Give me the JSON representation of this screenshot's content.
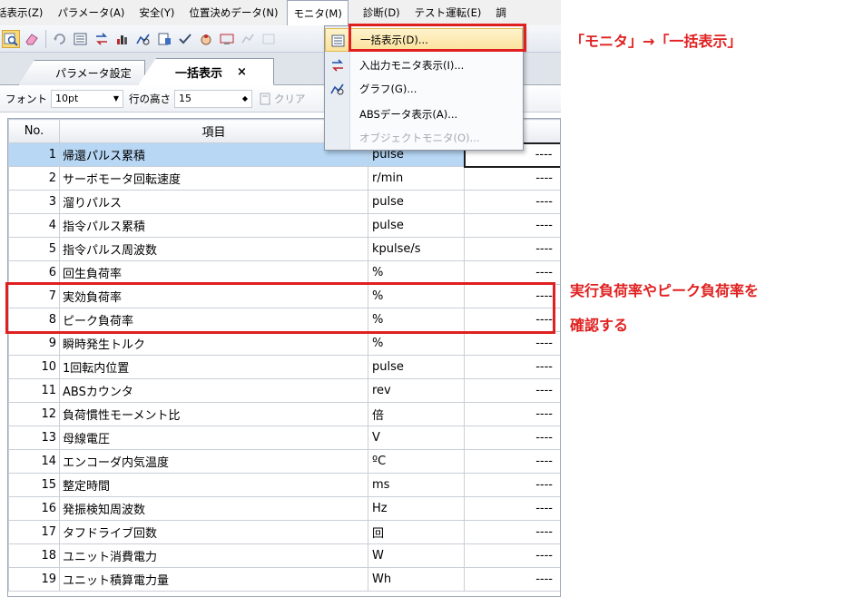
{
  "menubar": {
    "items": [
      {
        "label": "話表示(Z)"
      },
      {
        "label": "パラメータ(A)"
      },
      {
        "label": "安全(Y)"
      },
      {
        "label": "位置決めデータ(N)"
      },
      {
        "label": "モニタ(M)"
      },
      {
        "label": "診断(D)"
      },
      {
        "label": "テスト運転(E)"
      },
      {
        "label": "調"
      }
    ]
  },
  "tabs": {
    "tab1": "パラメータ設定",
    "tab2": "一括表示",
    "close": "×"
  },
  "fontbar": {
    "font_label": "フォント",
    "font_value": "10pt",
    "row_height_label": "行の高さ",
    "row_height_value": "15",
    "clear_label": "クリア"
  },
  "table": {
    "headers": {
      "no": "No.",
      "item": "項目"
    },
    "rows": [
      {
        "no": "1",
        "item": "帰還パルス累積",
        "unit": "pulse",
        "value": "----"
      },
      {
        "no": "2",
        "item": "サーボモータ回転速度",
        "unit": "r/min",
        "value": "----"
      },
      {
        "no": "3",
        "item": "溜りパルス",
        "unit": "pulse",
        "value": "----"
      },
      {
        "no": "4",
        "item": "指令パルス累積",
        "unit": "pulse",
        "value": "----"
      },
      {
        "no": "5",
        "item": "指令パルス周波数",
        "unit": "kpulse/s",
        "value": "----"
      },
      {
        "no": "6",
        "item": "回生負荷率",
        "unit": "%",
        "value": "----"
      },
      {
        "no": "7",
        "item": "実効負荷率",
        "unit": "%",
        "value": "----"
      },
      {
        "no": "8",
        "item": "ピーク負荷率",
        "unit": "%",
        "value": "----"
      },
      {
        "no": "9",
        "item": "瞬時発生トルク",
        "unit": "%",
        "value": "----"
      },
      {
        "no": "10",
        "item": "1回転内位置",
        "unit": "pulse",
        "value": "----"
      },
      {
        "no": "11",
        "item": "ABSカウンタ",
        "unit": "rev",
        "value": "----"
      },
      {
        "no": "12",
        "item": "負荷慣性モーメント比",
        "unit": "倍",
        "value": "----"
      },
      {
        "no": "13",
        "item": "母線電圧",
        "unit": "V",
        "value": "----"
      },
      {
        "no": "14",
        "item": "エンコーダ内気温度",
        "unit": "ºC",
        "value": "----"
      },
      {
        "no": "15",
        "item": "整定時間",
        "unit": "ms",
        "value": "----"
      },
      {
        "no": "16",
        "item": "発振検知周波数",
        "unit": "Hz",
        "value": "----"
      },
      {
        "no": "17",
        "item": "タフドライブ回数",
        "unit": "回",
        "value": "----"
      },
      {
        "no": "18",
        "item": "ユニット消費電力",
        "unit": "W",
        "value": "----"
      },
      {
        "no": "19",
        "item": "ユニット積算電力量",
        "unit": "Wh",
        "value": "----"
      }
    ]
  },
  "dropdown": {
    "items": [
      {
        "label": "一括表示(D)...",
        "icon": "batch-display-icon"
      },
      {
        "label": "入出力モニタ表示(I)...",
        "icon": "io-monitor-icon"
      },
      {
        "label": "グラフ(G)...",
        "icon": "graph-icon"
      },
      {
        "label": "ABSデータ表示(A)...",
        "icon": ""
      },
      {
        "label": "オブジェクトモニタ(O)...",
        "icon": ""
      }
    ]
  },
  "annotations": {
    "menu_note": "「モニタ」→「一括表示」",
    "table_note_line1": "実行負荷率やピーク負荷率を",
    "table_note_line2": "確認する"
  },
  "colors": {
    "highlight_red": "#e02020",
    "selected_row": "#b7d7f5",
    "menu_highlight": "#fbe29a"
  }
}
